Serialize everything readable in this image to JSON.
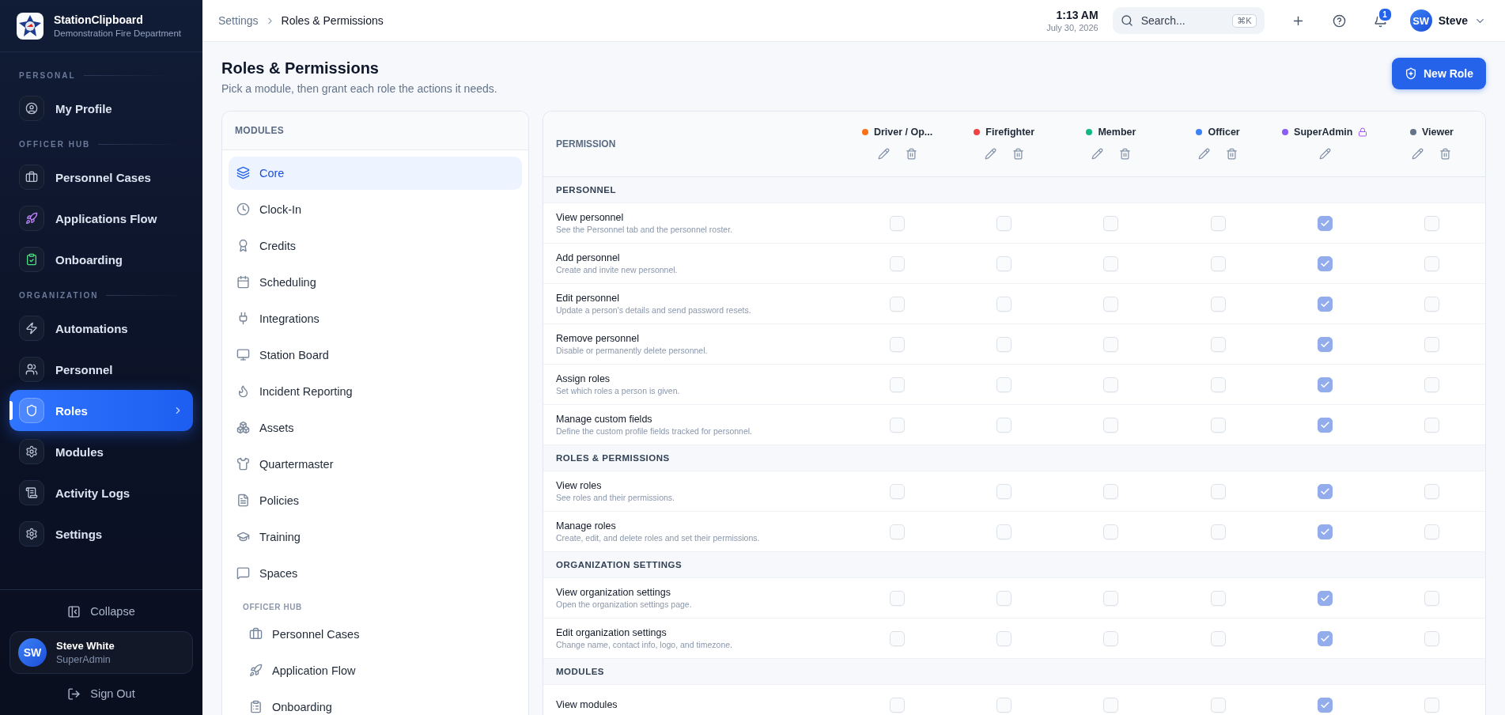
{
  "sidebar": {
    "brand": {
      "name": "StationClipboard",
      "subtitle": "Demonstration Fire Department"
    },
    "sections": [
      {
        "label": "PERSONAL",
        "items": [
          {
            "label": "My Profile",
            "selected": false
          }
        ]
      },
      {
        "label": "OFFICER HUB",
        "items": [
          {
            "label": "Personnel Cases",
            "selected": false
          },
          {
            "label": "Applications Flow",
            "selected": false
          },
          {
            "label": "Onboarding",
            "selected": false
          }
        ]
      },
      {
        "label": "ORGANIZATION",
        "items": [
          {
            "label": "Automations",
            "selected": false
          },
          {
            "label": "Personnel",
            "selected": false
          },
          {
            "label": "Roles",
            "selected": true
          },
          {
            "label": "Modules",
            "selected": false
          },
          {
            "label": "Activity Logs",
            "selected": false
          },
          {
            "label": "Settings",
            "selected": false
          }
        ]
      }
    ],
    "collapse": "Collapse",
    "user": {
      "initials": "SW",
      "name": "Steve White",
      "role": "SuperAdmin"
    },
    "sign_out": "Sign Out"
  },
  "topbar": {
    "breadcrumb": [
      "Settings",
      "Roles & Permissions"
    ],
    "time": "1:13 AM",
    "date": "July 30, 2026",
    "search": {
      "placeholder": "Search...",
      "shortcut": "⌘K"
    },
    "notifications": "1",
    "user": {
      "initials": "SW",
      "name": "Steve"
    }
  },
  "page": {
    "title": "Roles & Permissions",
    "subtitle": "Pick a module, then grant each role the actions it needs.",
    "new_role": "New Role"
  },
  "modules": {
    "heading": "MODULES",
    "items": [
      {
        "label": "Core",
        "selected": true
      },
      {
        "label": "Clock-In",
        "selected": false
      },
      {
        "label": "Credits",
        "selected": false
      },
      {
        "label": "Scheduling",
        "selected": false
      },
      {
        "label": "Integrations",
        "selected": false
      },
      {
        "label": "Station Board",
        "selected": false
      },
      {
        "label": "Incident Reporting",
        "selected": false
      },
      {
        "label": "Assets",
        "selected": false
      },
      {
        "label": "Quartermaster",
        "selected": false
      },
      {
        "label": "Policies",
        "selected": false
      },
      {
        "label": "Training",
        "selected": false
      },
      {
        "label": "Spaces",
        "selected": false
      }
    ],
    "groups": [
      {
        "label": "OFFICER HUB",
        "items": [
          {
            "label": "Personnel Cases",
            "selected": false
          },
          {
            "label": "Application Flow",
            "selected": false
          },
          {
            "label": "Onboarding",
            "selected": false
          }
        ]
      }
    ]
  },
  "permissions": {
    "heading": "PERMISSION",
    "roles": [
      {
        "name": "Driver / Op...",
        "color": "#f97316",
        "locked": false
      },
      {
        "name": "Firefighter",
        "color": "#ef4444",
        "locked": false
      },
      {
        "name": "Member",
        "color": "#10b981",
        "locked": false
      },
      {
        "name": "Officer",
        "color": "#3b82f6",
        "locked": false
      },
      {
        "name": "SuperAdmin",
        "color": "#8b5cf6",
        "locked": true
      },
      {
        "name": "Viewer",
        "color": "#64748b",
        "locked": false
      }
    ],
    "groups": [
      {
        "title": "PERSONNEL",
        "rows": [
          {
            "name": "View personnel",
            "description": "See the Personnel tab and the personnel roster.",
            "checked": [
              false,
              false,
              false,
              false,
              true,
              false
            ]
          },
          {
            "name": "Add personnel",
            "description": "Create and invite new personnel.",
            "checked": [
              false,
              false,
              false,
              false,
              true,
              false
            ]
          },
          {
            "name": "Edit personnel",
            "description": "Update a person's details and send password resets.",
            "checked": [
              false,
              false,
              false,
              false,
              true,
              false
            ]
          },
          {
            "name": "Remove personnel",
            "description": "Disable or permanently delete personnel.",
            "checked": [
              false,
              false,
              false,
              false,
              true,
              false
            ]
          },
          {
            "name": "Assign roles",
            "description": "Set which roles a person is given.",
            "checked": [
              false,
              false,
              false,
              false,
              true,
              false
            ]
          },
          {
            "name": "Manage custom fields",
            "description": "Define the custom profile fields tracked for personnel.",
            "checked": [
              false,
              false,
              false,
              false,
              true,
              false
            ]
          }
        ]
      },
      {
        "title": "ROLES & PERMISSIONS",
        "rows": [
          {
            "name": "View roles",
            "description": "See roles and their permissions.",
            "checked": [
              false,
              false,
              false,
              false,
              true,
              false
            ]
          },
          {
            "name": "Manage roles",
            "description": "Create, edit, and delete roles and set their permissions.",
            "checked": [
              false,
              false,
              false,
              false,
              true,
              false
            ]
          }
        ]
      },
      {
        "title": "ORGANIZATION SETTINGS",
        "rows": [
          {
            "name": "View organization settings",
            "description": "Open the organization settings page.",
            "checked": [
              false,
              false,
              false,
              false,
              true,
              false
            ]
          },
          {
            "name": "Edit organization settings",
            "description": "Change name, contact info, logo, and timezone.",
            "checked": [
              false,
              false,
              false,
              false,
              true,
              false
            ]
          }
        ]
      },
      {
        "title": "MODULES",
        "rows": [
          {
            "name": "View modules",
            "checked": [
              false,
              false,
              false,
              false,
              true,
              false
            ]
          }
        ]
      }
    ]
  }
}
